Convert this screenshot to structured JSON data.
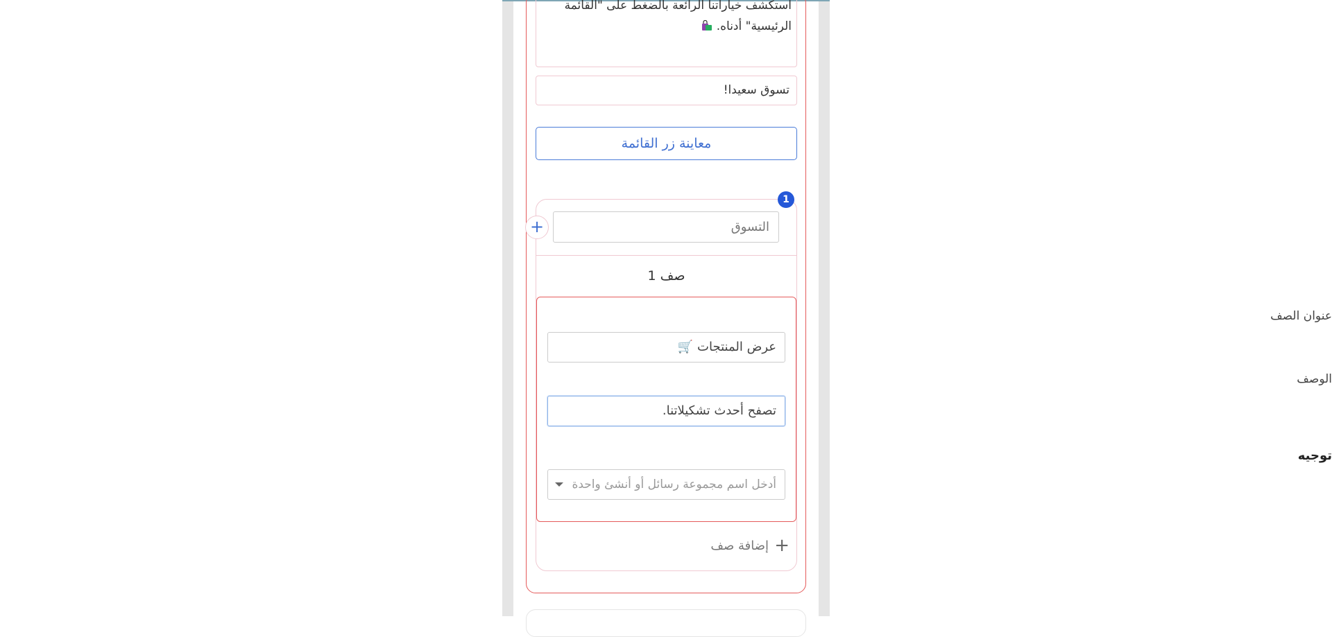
{
  "message": {
    "body_line1": "استكشف خياراتنا الرائعة بالضغط على \"القائمة",
    "body_line2": "الرئيسية\" أدناه.",
    "body_emoji": "shopping-bags-icon",
    "footer": "تسوق سعيدا!"
  },
  "preview_button": {
    "label": "معاينة زر القائمة"
  },
  "section": {
    "badge": "1",
    "title_value": "التسوق",
    "row_heading": "صف 1"
  },
  "row": {
    "title_label": "عنوان الصف",
    "title_value": "عرض المنتجات 🛒",
    "description_label": "الوصف",
    "description_value": "تصفح أحدث تشكيلاتنا.",
    "routing_label": "توجيه",
    "routing_placeholder": "أدخل اسم مجموعة رسائل أو أنشئ واحدة"
  },
  "add_row": {
    "label": "إضافة صف"
  },
  "colors": {
    "accent": "#3f6fd1",
    "error_border": "#e55a5a",
    "badge_bg": "#2558d8"
  }
}
